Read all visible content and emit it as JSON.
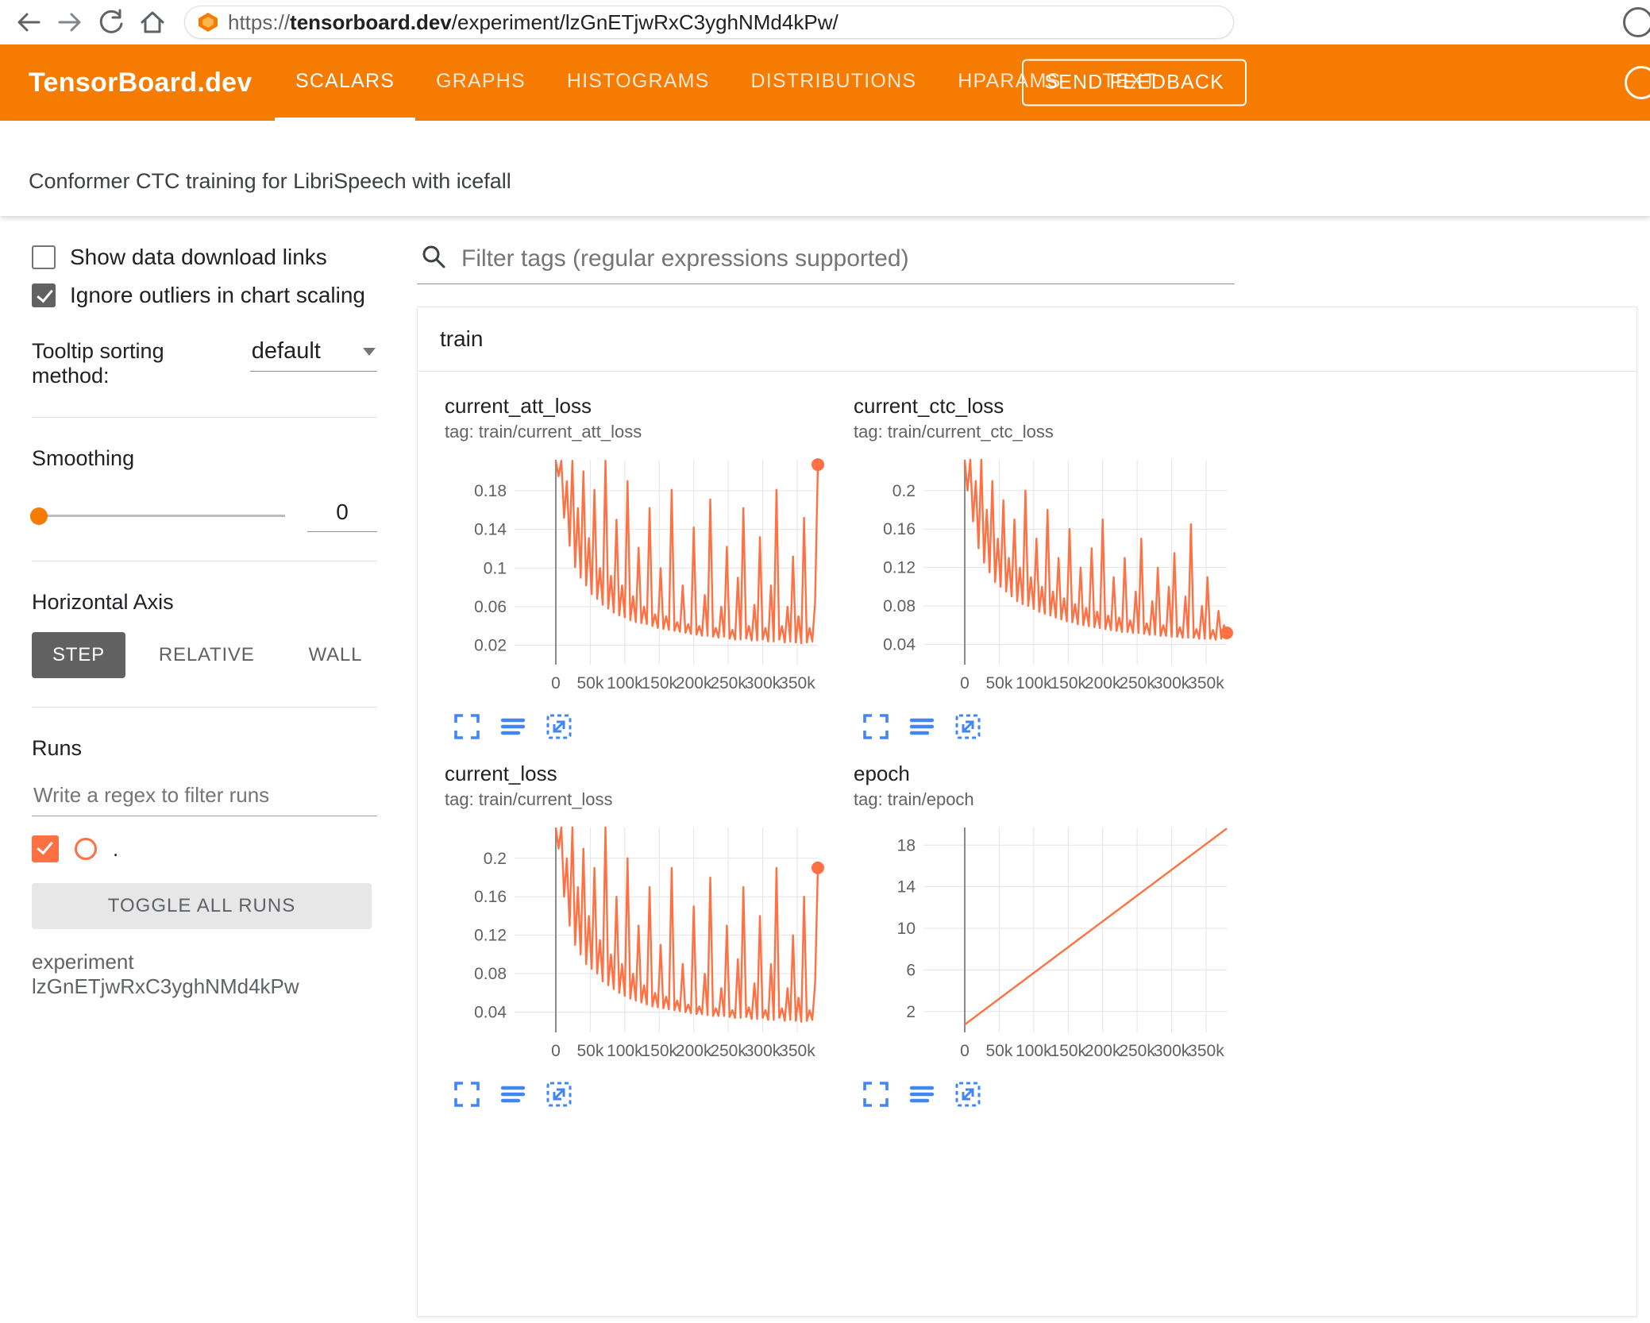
{
  "browser": {
    "url_scheme": "https://",
    "url_domain": "tensorboard.dev",
    "url_path": "/experiment/lzGnETjwRxC3yghNMd4kPw/"
  },
  "header": {
    "brand": "TensorBoard.dev",
    "tabs": [
      {
        "label": "SCALARS",
        "active": true
      },
      {
        "label": "GRAPHS",
        "active": false
      },
      {
        "label": "HISTOGRAMS",
        "active": false
      },
      {
        "label": "DISTRIBUTIONS",
        "active": false
      },
      {
        "label": "HPARAMS",
        "active": false
      },
      {
        "label": "TEXT",
        "active": false
      }
    ],
    "feedback_button": "SEND FEEDBACK"
  },
  "experiment": {
    "title": "Conformer CTC training for LibriSpeech with icefall"
  },
  "sidebar": {
    "show_download": {
      "label": "Show data download links",
      "checked": false
    },
    "ignore_outliers": {
      "label": "Ignore outliers in chart scaling",
      "checked": true
    },
    "tooltip_sorting": {
      "label": "Tooltip sorting method:",
      "value": "default"
    },
    "smoothing": {
      "label": "Smoothing",
      "value": "0"
    },
    "horizontal_axis": {
      "label": "Horizontal Axis",
      "options": [
        "STEP",
        "RELATIVE",
        "WALL"
      ],
      "selected": "STEP"
    },
    "runs": {
      "label": "Runs",
      "filter_placeholder": "Write a regex to filter runs",
      "run_checked": true,
      "run_label": ".",
      "toggle_button": "TOGGLE ALL RUNS",
      "experiment_note": "experiment lzGnETjwRxC3yghNMd4kPw"
    }
  },
  "main": {
    "filter_placeholder": "Filter tags (regular expressions supported)",
    "section": "train"
  },
  "colors": {
    "header_orange": "#f57c00",
    "run": "#ff7043",
    "icon_blue": "#4285f4",
    "selected_button_gray": "#616161"
  },
  "chart_data": [
    {
      "type": "line",
      "title": "current_att_loss",
      "tag": "tag: train/current_att_loss",
      "xlabel": "step",
      "ylabel": "",
      "x_ticks": [
        "0",
        "50k",
        "100k",
        "150k",
        "200k",
        "250k",
        "300k",
        "350k"
      ],
      "x_tick_values": [
        0,
        50000,
        100000,
        150000,
        200000,
        250000,
        300000,
        350000
      ],
      "x_max": 380000,
      "x_step": 4000,
      "y_ticks": [
        0.02,
        0.06,
        0.1,
        0.14,
        0.18
      ],
      "y_tick_labels": [
        "0.02",
        "0.06",
        "0.1",
        "0.14",
        "0.18"
      ],
      "ylim": [
        0,
        0.212
      ],
      "end_dot": true,
      "values": [
        0.211,
        0.195,
        0.211,
        0.152,
        0.19,
        0.123,
        0.211,
        0.101,
        0.162,
        0.09,
        0.2,
        0.082,
        0.131,
        0.073,
        0.181,
        0.068,
        0.1,
        0.062,
        0.211,
        0.058,
        0.092,
        0.054,
        0.15,
        0.051,
        0.082,
        0.049,
        0.19,
        0.046,
        0.071,
        0.044,
        0.121,
        0.043,
        0.06,
        0.042,
        0.162,
        0.04,
        0.052,
        0.038,
        0.1,
        0.037,
        0.05,
        0.036,
        0.181,
        0.035,
        0.044,
        0.034,
        0.082,
        0.033,
        0.042,
        0.032,
        0.142,
        0.031,
        0.04,
        0.03,
        0.072,
        0.03,
        0.171,
        0.029,
        0.038,
        0.028,
        0.06,
        0.029,
        0.122,
        0.027,
        0.036,
        0.026,
        0.09,
        0.026,
        0.162,
        0.027,
        0.04,
        0.025,
        0.062,
        0.025,
        0.132,
        0.026,
        0.038,
        0.024,
        0.082,
        0.024,
        0.181,
        0.026,
        0.04,
        0.023,
        0.06,
        0.024,
        0.112,
        0.023,
        0.05,
        0.022,
        0.152,
        0.023,
        0.038,
        0.024,
        0.065,
        0.207
      ]
    },
    {
      "type": "line",
      "title": "current_ctc_loss",
      "tag": "tag: train/current_ctc_loss",
      "xlabel": "step",
      "ylabel": "",
      "x_ticks": [
        "0",
        "50k",
        "100k",
        "150k",
        "200k",
        "250k",
        "300k",
        "350k"
      ],
      "x_tick_values": [
        0,
        50000,
        100000,
        150000,
        200000,
        250000,
        300000,
        350000
      ],
      "x_max": 380000,
      "x_step": 4000,
      "y_ticks": [
        0.04,
        0.08,
        0.12,
        0.16,
        0.2
      ],
      "y_tick_labels": [
        "0.04",
        "0.08",
        "0.12",
        "0.16",
        "0.2"
      ],
      "ylim": [
        0.019,
        0.232
      ],
      "end_dot": true,
      "values": [
        0.232,
        0.2,
        0.232,
        0.168,
        0.21,
        0.14,
        0.232,
        0.125,
        0.18,
        0.115,
        0.21,
        0.105,
        0.15,
        0.1,
        0.19,
        0.095,
        0.13,
        0.09,
        0.17,
        0.085,
        0.12,
        0.082,
        0.2,
        0.08,
        0.11,
        0.077,
        0.15,
        0.074,
        0.1,
        0.072,
        0.18,
        0.07,
        0.095,
        0.068,
        0.13,
        0.066,
        0.088,
        0.064,
        0.16,
        0.063,
        0.082,
        0.061,
        0.12,
        0.06,
        0.078,
        0.059,
        0.14,
        0.058,
        0.074,
        0.057,
        0.17,
        0.056,
        0.07,
        0.055,
        0.11,
        0.054,
        0.068,
        0.053,
        0.13,
        0.053,
        0.065,
        0.052,
        0.095,
        0.052,
        0.15,
        0.051,
        0.062,
        0.05,
        0.085,
        0.05,
        0.12,
        0.049,
        0.06,
        0.049,
        0.1,
        0.048,
        0.135,
        0.048,
        0.058,
        0.047,
        0.09,
        0.047,
        0.165,
        0.047,
        0.056,
        0.046,
        0.08,
        0.046,
        0.11,
        0.046,
        0.055,
        0.045,
        0.075,
        0.046,
        0.06,
        0.052
      ]
    },
    {
      "type": "line",
      "title": "current_loss",
      "tag": "tag: train/current_loss",
      "xlabel": "step",
      "ylabel": "",
      "x_ticks": [
        "0",
        "50k",
        "100k",
        "150k",
        "200k",
        "250k",
        "300k",
        "350k"
      ],
      "x_tick_values": [
        0,
        50000,
        100000,
        150000,
        200000,
        250000,
        300000,
        350000
      ],
      "x_max": 380000,
      "x_step": 4000,
      "y_ticks": [
        0.04,
        0.08,
        0.12,
        0.16,
        0.2
      ],
      "y_tick_labels": [
        "0.04",
        "0.08",
        "0.12",
        "0.16",
        "0.2"
      ],
      "ylim": [
        0.019,
        0.232
      ],
      "end_dot": true,
      "values": [
        0.232,
        0.21,
        0.232,
        0.16,
        0.2,
        0.13,
        0.232,
        0.11,
        0.17,
        0.1,
        0.21,
        0.09,
        0.14,
        0.085,
        0.19,
        0.08,
        0.115,
        0.072,
        0.232,
        0.068,
        0.1,
        0.064,
        0.16,
        0.06,
        0.09,
        0.057,
        0.2,
        0.054,
        0.08,
        0.052,
        0.13,
        0.05,
        0.068,
        0.048,
        0.17,
        0.046,
        0.06,
        0.045,
        0.11,
        0.044,
        0.056,
        0.043,
        0.19,
        0.042,
        0.052,
        0.041,
        0.09,
        0.04,
        0.048,
        0.039,
        0.15,
        0.038,
        0.046,
        0.038,
        0.08,
        0.037,
        0.18,
        0.036,
        0.044,
        0.036,
        0.065,
        0.036,
        0.13,
        0.035,
        0.042,
        0.034,
        0.095,
        0.034,
        0.17,
        0.035,
        0.045,
        0.033,
        0.07,
        0.033,
        0.14,
        0.034,
        0.042,
        0.032,
        0.09,
        0.032,
        0.19,
        0.034,
        0.044,
        0.031,
        0.065,
        0.032,
        0.12,
        0.031,
        0.055,
        0.03,
        0.16,
        0.031,
        0.042,
        0.032,
        0.07,
        0.19
      ]
    },
    {
      "type": "line",
      "title": "epoch",
      "tag": "tag: train/epoch",
      "xlabel": "step",
      "ylabel": "",
      "x_ticks": [
        "0",
        "50k",
        "100k",
        "150k",
        "200k",
        "250k",
        "300k",
        "350k"
      ],
      "x_tick_values": [
        0,
        50000,
        100000,
        150000,
        200000,
        250000,
        300000,
        350000
      ],
      "x_max": 380000,
      "y_ticks": [
        2,
        6,
        10,
        14,
        18
      ],
      "y_tick_labels": [
        "2",
        "6",
        "10",
        "14",
        "18"
      ],
      "ylim": [
        0,
        19.7
      ],
      "end_dot": false,
      "x": [
        0,
        380000
      ],
      "values": [
        0.75,
        19.6
      ]
    }
  ]
}
